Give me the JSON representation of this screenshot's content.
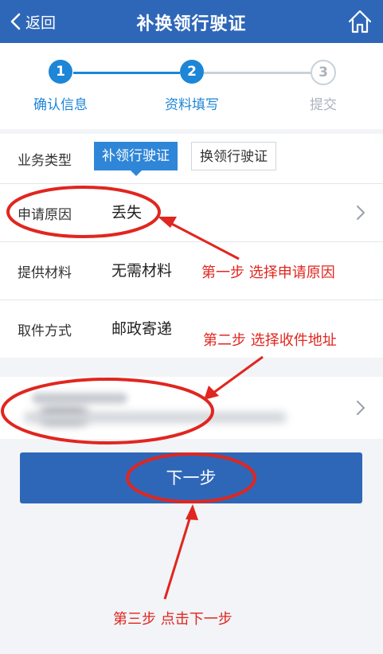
{
  "header": {
    "back_label": "返回",
    "title": "补换领行驶证"
  },
  "stepper": {
    "steps": [
      {
        "number": "1",
        "label": "确认信息"
      },
      {
        "number": "2",
        "label": "资料填写"
      },
      {
        "number": "3",
        "label": "提交"
      }
    ]
  },
  "form": {
    "business_type": {
      "label": "业务类型",
      "options": [
        "补领行驶证",
        "换领行驶证"
      ],
      "selected": "补领行驶证"
    },
    "reason": {
      "label": "申请原因",
      "value": "丢失"
    },
    "materials": {
      "label": "提供材料",
      "value": "无需材料"
    },
    "pickup": {
      "label": "取件方式",
      "value": "邮政寄递"
    }
  },
  "next_button": {
    "label": "下一步"
  },
  "annotations": {
    "step1": "第一步 选择申请原因",
    "step2": "第二步 选择收件地址",
    "step3": "第三步 点击下一步"
  },
  "colors": {
    "brand": "#2f67b8",
    "accent": "#1d86d6",
    "annotation": "#e0261f"
  }
}
